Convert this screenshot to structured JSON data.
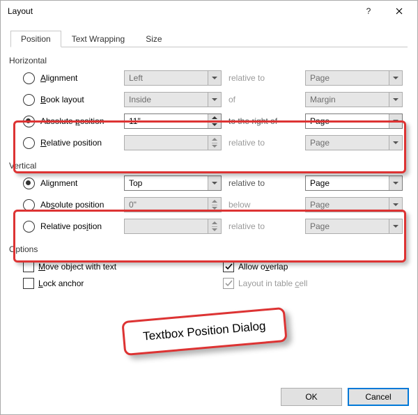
{
  "window": {
    "title": "Layout"
  },
  "tabs": {
    "position": "Position",
    "wrapping": "Text Wrapping",
    "size": "Size"
  },
  "groups": {
    "horizontal": "Horizontal",
    "vertical": "Vertical",
    "options": "Options"
  },
  "horiz": {
    "alignment": {
      "label": "Alignment",
      "value": "Left",
      "rel_label": "relative to",
      "rel_value": "Page"
    },
    "book": {
      "label": "Book layout",
      "value": "Inside",
      "rel_label": "of",
      "rel_value": "Margin"
    },
    "absolute": {
      "label": "Absolute position",
      "value": "11\"",
      "rel_label": "to the right of",
      "rel_value": "Page"
    },
    "relative": {
      "label": "Relative position",
      "value": "",
      "rel_label": "relative to",
      "rel_value": "Page"
    }
  },
  "vert": {
    "alignment": {
      "label": "Alignment",
      "value": "Top",
      "rel_label": "relative to",
      "rel_value": "Page"
    },
    "absolute": {
      "label": "Absolute position",
      "value": "0\"",
      "rel_label": "below",
      "rel_value": "Page"
    },
    "relative": {
      "label": "Relative position",
      "value": "",
      "rel_label": "relative to",
      "rel_value": "Page"
    }
  },
  "opts": {
    "move": "Move object with text",
    "lock": "Lock anchor",
    "overlap": "Allow overlap",
    "layout_cell": "Layout in table cell"
  },
  "buttons": {
    "ok": "OK",
    "cancel": "Cancel"
  },
  "callout": "Textbox Position Dialog"
}
